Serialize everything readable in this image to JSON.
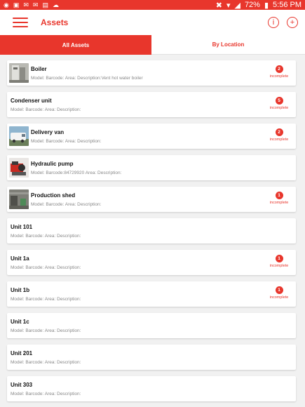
{
  "status_bar": {
    "left_icons": [
      "location-icon",
      "image-icon",
      "mail-icon",
      "mail-icon",
      "bag-icon",
      "cloud-icon"
    ],
    "battery": "72%",
    "time": "5:56 PM"
  },
  "app_bar": {
    "title": "Assets",
    "info_icon": "info-icon",
    "add_icon": "add-icon",
    "info_glyph": "i",
    "add_glyph": "+"
  },
  "tabs": [
    {
      "label": "All Assets",
      "active": true
    },
    {
      "label": "By Location",
      "active": false
    }
  ],
  "assets": [
    {
      "name": "Boiler",
      "meta": "Model: Barcode: Area: Description:Vent hot water boiler",
      "thumb": "boiler",
      "badge": "2",
      "badge_text": "incomplete"
    },
    {
      "name": "Condenser unit",
      "meta": "Model: Barcode: Area: Description:",
      "thumb": "",
      "badge": "5",
      "badge_text": "incomplete"
    },
    {
      "name": "Delivery van",
      "meta": "Model: Barcode: Area: Description:",
      "thumb": "van",
      "badge": "2",
      "badge_text": "incomplete"
    },
    {
      "name": "Hydraulic pump",
      "meta": "Model: Barcode:84729920 Area: Description:",
      "thumb": "pump",
      "badge": "",
      "badge_text": ""
    },
    {
      "name": "Production shed",
      "meta": "Model: Barcode: Area: Description:",
      "thumb": "shed",
      "badge": "1",
      "badge_text": "incomplete"
    },
    {
      "name": "Unit 101",
      "meta": "Model: Barcode: Area: Description:",
      "thumb": "",
      "badge": "",
      "badge_text": ""
    },
    {
      "name": "Unit 1a",
      "meta": "Model: Barcode: Area: Description:",
      "thumb": "",
      "badge": "1",
      "badge_text": "incomplete"
    },
    {
      "name": "Unit 1b",
      "meta": "Model: Barcode: Area: Description:",
      "thumb": "",
      "badge": "1",
      "badge_text": "incomplete"
    },
    {
      "name": "Unit 1c",
      "meta": "Model: Barcode: Area: Description:",
      "thumb": "",
      "badge": "",
      "badge_text": ""
    },
    {
      "name": "Unit 201",
      "meta": "Model: Barcode: Area: Description:",
      "thumb": "",
      "badge": "",
      "badge_text": ""
    },
    {
      "name": "Unit 303",
      "meta": "Model: Barcode: Area: Description:",
      "thumb": "",
      "badge": "",
      "badge_text": ""
    }
  ],
  "colors": {
    "accent": "#e8362c"
  }
}
